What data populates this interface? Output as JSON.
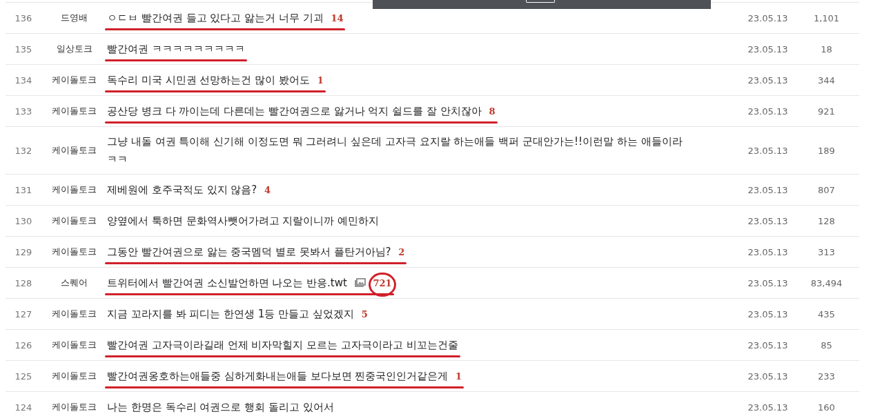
{
  "toast": {
    "visible": true
  },
  "rows": [
    {
      "number": "136",
      "category": "드영배",
      "title": "ㅇㄷㅂ 빨간여권 들고 있다고 앓는거 너무 기괴",
      "comments": "14",
      "has_image": false,
      "underlined": true,
      "circled": false,
      "date": "23.05.13",
      "views": "1,101"
    },
    {
      "number": "135",
      "category": "일상토크",
      "title": "빨간여권 ㅋㅋㅋㅋㅋㅋㅋㅋㅋ",
      "has_image": false,
      "underlined": true,
      "circled": false,
      "date": "23.05.13",
      "views": "18"
    },
    {
      "number": "134",
      "category": "케이돌토크",
      "title": "독수리 미국 시민권 선망하는건 많이 봤어도",
      "comments": "1",
      "has_image": false,
      "underlined": true,
      "circled": false,
      "date": "23.05.13",
      "views": "344"
    },
    {
      "number": "133",
      "category": "케이돌토크",
      "title": "공산당 병크 다 까이는데 다른데는 빨간여권으로 앓거나 억지 쉴드를 잘 안치잖아",
      "comments": "8",
      "has_image": false,
      "underlined": true,
      "circled": false,
      "date": "23.05.13",
      "views": "921"
    },
    {
      "number": "132",
      "category": "케이돌토크",
      "title": "그냥 내돌 여권 특이해 신기해 이정도면 뭐 그러려니 싶은데 고자극 요지랄 하는애들 백퍼 군대안가는!!이런말 하는 애들이라 ㅋㅋ",
      "has_image": false,
      "underlined": false,
      "circled": false,
      "date": "23.05.13",
      "views": "189"
    },
    {
      "number": "131",
      "category": "케이돌토크",
      "title": "제베원에 호주국적도 있지 않음?",
      "comments": "4",
      "has_image": false,
      "underlined": false,
      "circled": false,
      "date": "23.05.13",
      "views": "807"
    },
    {
      "number": "130",
      "category": "케이돌토크",
      "title": "양옆에서 툭하면 문화역사뺏어가려고 지랄이니까 예민하지",
      "has_image": false,
      "underlined": false,
      "circled": false,
      "date": "23.05.13",
      "views": "128"
    },
    {
      "number": "129",
      "category": "케이돌토크",
      "title": "그동안 빨간여권으로 앓는 중국멤덕 별로 못봐서 플탄거아님?",
      "comments": "2",
      "has_image": false,
      "underlined": true,
      "circled": false,
      "date": "23.05.13",
      "views": "313"
    },
    {
      "number": "128",
      "category": "스퀘어",
      "title": "트위터에서 빨간여권 소신발언하면 나오는 반응.twt",
      "comments": "721",
      "has_image": true,
      "underlined": true,
      "circled": true,
      "date": "23.05.13",
      "views": "83,494"
    },
    {
      "number": "127",
      "category": "케이돌토크",
      "title": "지금 꼬라지를 봐 피디는 한연생 1등 만들고 싶었겠지",
      "comments": "5",
      "has_image": false,
      "underlined": false,
      "circled": false,
      "date": "23.05.13",
      "views": "435"
    },
    {
      "number": "126",
      "category": "케이돌토크",
      "title": "빨간여권 고자극이라길래 언제 비자막힐지 모르는 고자극이라고 비꼬는건줄",
      "has_image": false,
      "underlined": true,
      "circled": false,
      "date": "23.05.13",
      "views": "85"
    },
    {
      "number": "125",
      "category": "케이돌토크",
      "title": "빨간여권옹호하는애들중 심하게화내는애들 보다보면 찐중국인인거같은게",
      "comments": "1",
      "has_image": false,
      "underlined": true,
      "circled": false,
      "date": "23.05.13",
      "views": "233"
    },
    {
      "number": "124",
      "category": "케이돌토크",
      "title": "나는 한명은 독수리 여권으로 행회 돌리고 있어서",
      "has_image": false,
      "underlined": false,
      "circled": false,
      "date": "23.05.13",
      "views": "160"
    }
  ]
}
